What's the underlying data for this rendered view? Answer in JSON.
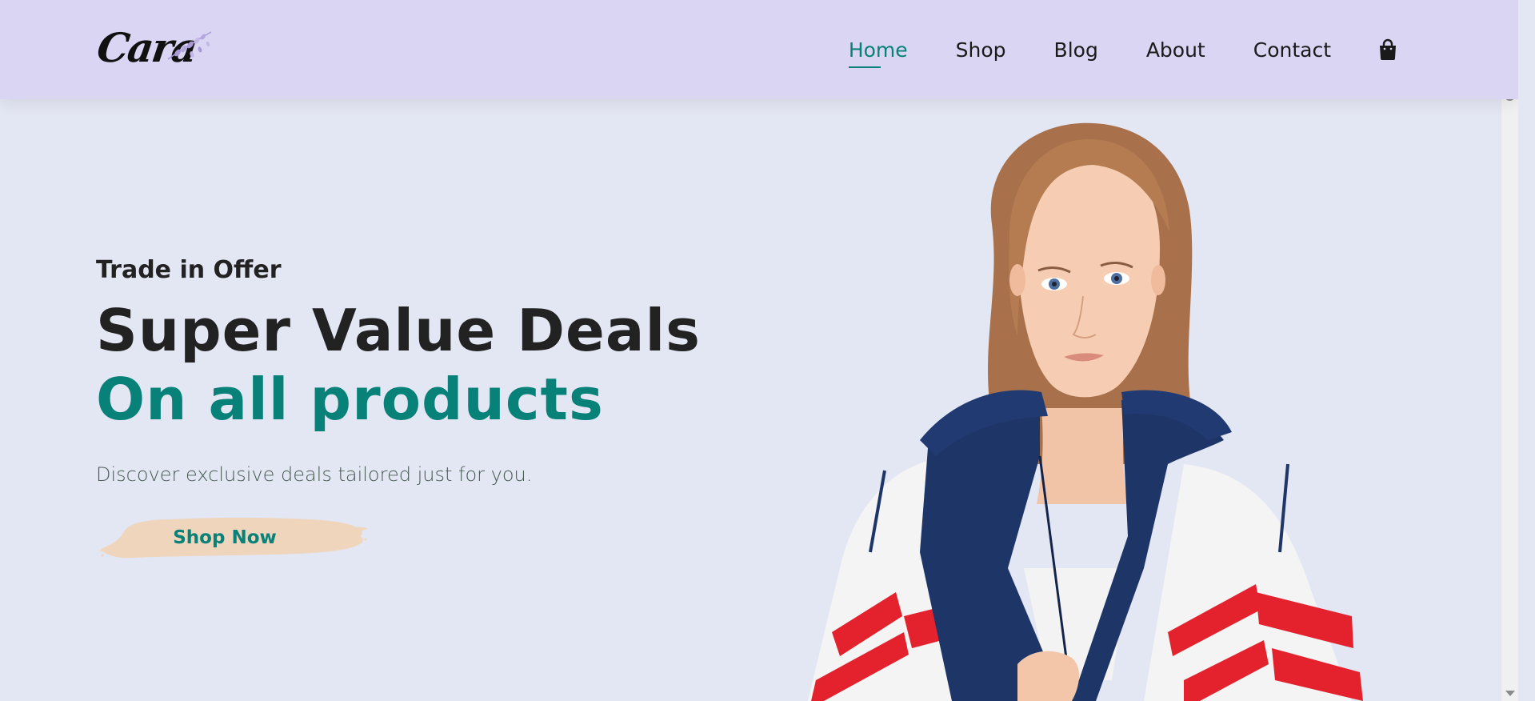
{
  "brand": {
    "logo_text": "Cara"
  },
  "nav": {
    "items": [
      {
        "label": "Home",
        "active": true
      },
      {
        "label": "Shop",
        "active": false
      },
      {
        "label": "Blog",
        "active": false
      },
      {
        "label": "About",
        "active": false
      },
      {
        "label": "Contact",
        "active": false
      }
    ],
    "cart_icon": "shopping-bag-icon"
  },
  "hero": {
    "kicker": "Trade in Offer",
    "title": "Super Value Deals",
    "accent": "On all products",
    "description": "Discover exclusive deals tailored just for you.",
    "cta_label": "Shop Now"
  },
  "colors": {
    "header_bg": "#d9d5f3",
    "page_bg": "#e3e6f3",
    "accent": "#088178",
    "button_brush": "#efd5bb",
    "text_dark": "#222222"
  }
}
